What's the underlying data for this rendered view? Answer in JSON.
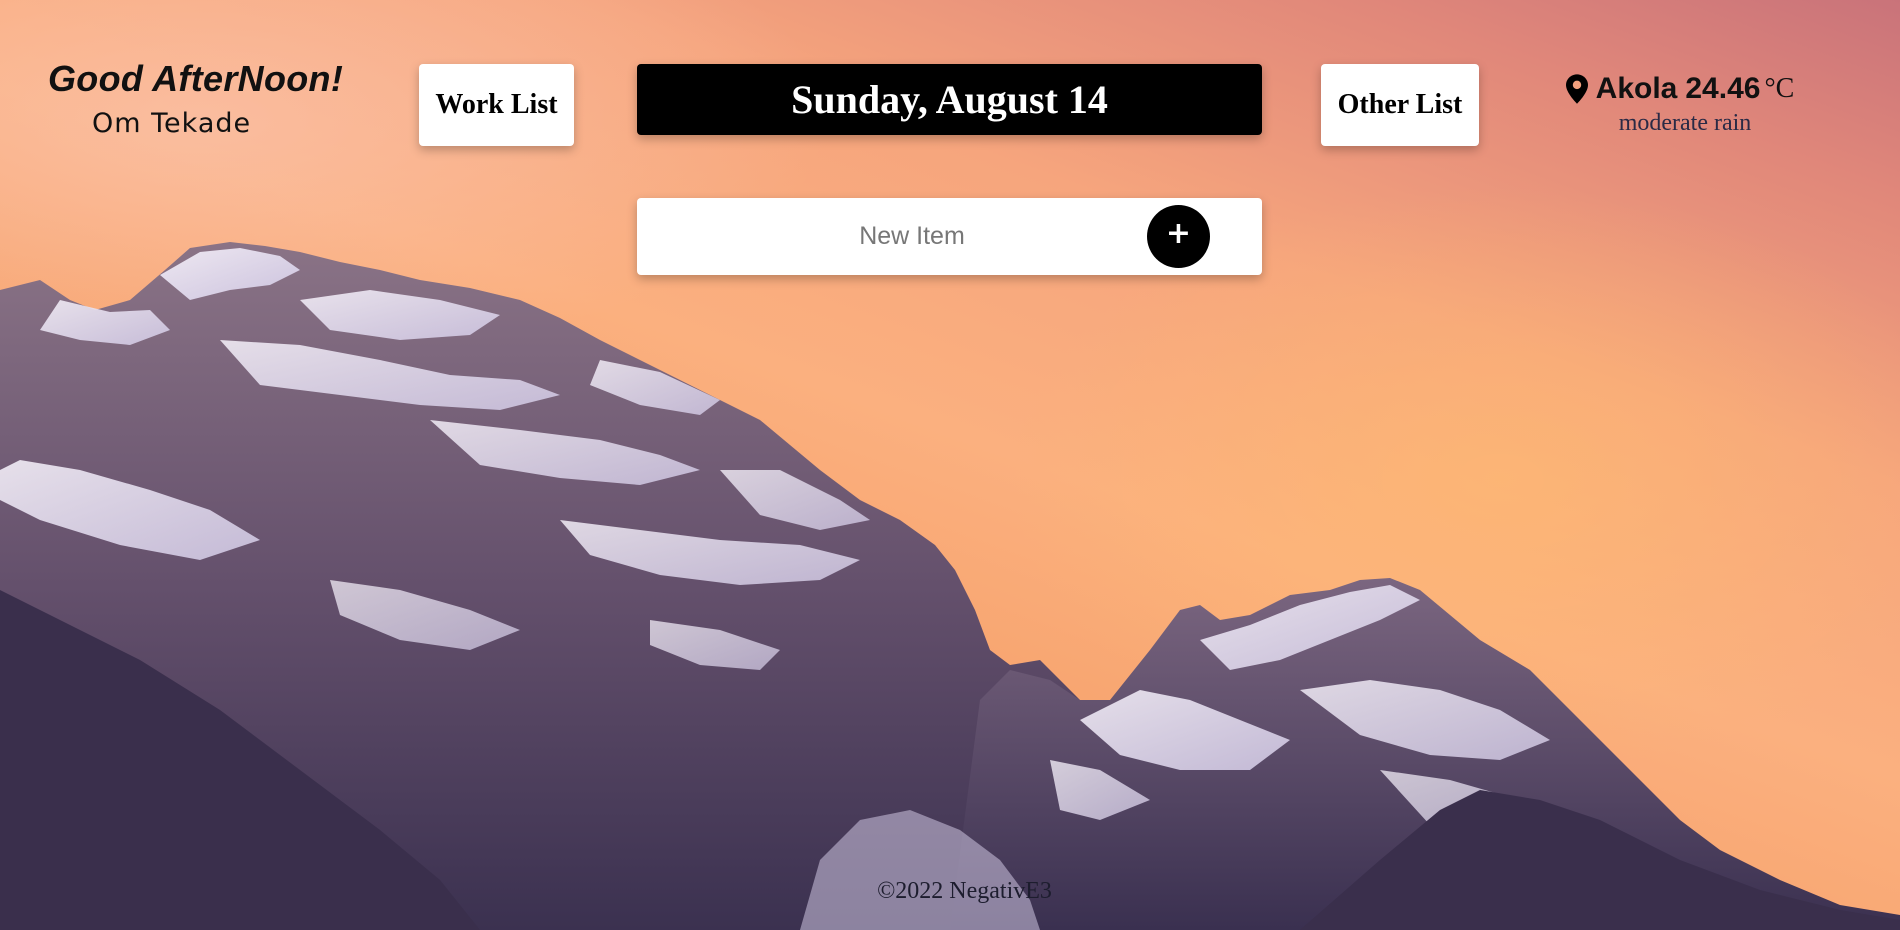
{
  "greeting": {
    "title": "Good AfterNoon!",
    "name": "Om Tekade"
  },
  "nav": {
    "work_list_label": "Work List",
    "other_list_label": "Other List"
  },
  "date": {
    "label": "Sunday, August 14"
  },
  "new_item": {
    "placeholder": "New Item",
    "value": "",
    "add_label": "+"
  },
  "weather": {
    "icon": "map-pin-icon",
    "city": "Akola",
    "temperature": "24.46",
    "unit": "°C",
    "description": "moderate rain"
  },
  "footer": {
    "copyright": "©2022 NegativE3"
  },
  "colors": {
    "sky_top": "#c9737a",
    "sky_mid": "#fbb07f",
    "sky_bottom": "#f08a63",
    "mountain_shadow": "#3d3352",
    "mountain_rock": "#6a5670",
    "snow": "#ece6f3",
    "date_bg": "#000000",
    "button_bg": "#ffffff"
  }
}
